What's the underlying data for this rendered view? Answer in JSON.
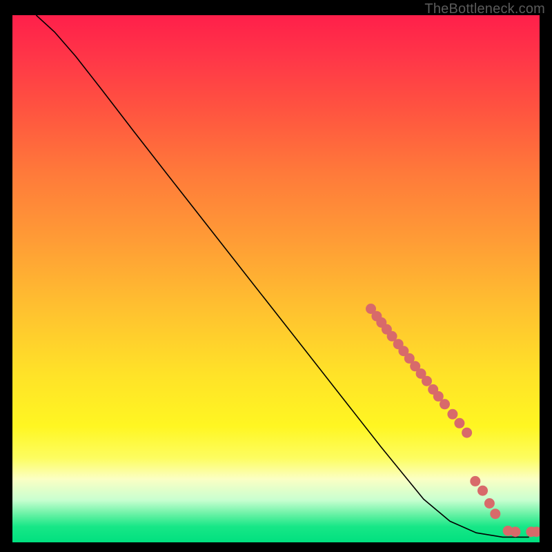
{
  "watermark": "TheBottleneck.com",
  "chart_data": {
    "type": "line",
    "title": "",
    "xlabel": "",
    "ylabel": "",
    "xlim": [
      0,
      1
    ],
    "ylim": [
      0,
      1
    ],
    "curve": [
      {
        "x": 0.045,
        "y": 1.0
      },
      {
        "x": 0.08,
        "y": 0.968
      },
      {
        "x": 0.12,
        "y": 0.922
      },
      {
        "x": 0.17,
        "y": 0.858
      },
      {
        "x": 0.23,
        "y": 0.78
      },
      {
        "x": 0.3,
        "y": 0.69
      },
      {
        "x": 0.38,
        "y": 0.588
      },
      {
        "x": 0.46,
        "y": 0.486
      },
      {
        "x": 0.54,
        "y": 0.384
      },
      {
        "x": 0.62,
        "y": 0.282
      },
      {
        "x": 0.7,
        "y": 0.18
      },
      {
        "x": 0.78,
        "y": 0.082
      },
      {
        "x": 0.83,
        "y": 0.04
      },
      {
        "x": 0.88,
        "y": 0.018
      },
      {
        "x": 0.93,
        "y": 0.01
      },
      {
        "x": 0.98,
        "y": 0.01
      }
    ],
    "markers": [
      {
        "x": 0.68,
        "y": 0.443
      },
      {
        "x": 0.691,
        "y": 0.429
      },
      {
        "x": 0.7,
        "y": 0.417
      },
      {
        "x": 0.71,
        "y": 0.404
      },
      {
        "x": 0.72,
        "y": 0.391
      },
      {
        "x": 0.732,
        "y": 0.376
      },
      {
        "x": 0.742,
        "y": 0.363
      },
      {
        "x": 0.753,
        "y": 0.349
      },
      {
        "x": 0.764,
        "y": 0.334
      },
      {
        "x": 0.775,
        "y": 0.32
      },
      {
        "x": 0.786,
        "y": 0.306
      },
      {
        "x": 0.798,
        "y": 0.29
      },
      {
        "x": 0.808,
        "y": 0.277
      },
      {
        "x": 0.82,
        "y": 0.262
      },
      {
        "x": 0.835,
        "y": 0.243
      },
      {
        "x": 0.848,
        "y": 0.226
      },
      {
        "x": 0.862,
        "y": 0.208
      },
      {
        "x": 0.878,
        "y": 0.116
      },
      {
        "x": 0.892,
        "y": 0.098
      },
      {
        "x": 0.905,
        "y": 0.074
      },
      {
        "x": 0.916,
        "y": 0.054
      },
      {
        "x": 0.94,
        "y": 0.022
      },
      {
        "x": 0.954,
        "y": 0.02
      },
      {
        "x": 0.984,
        "y": 0.02
      },
      {
        "x": 0.994,
        "y": 0.02
      }
    ],
    "marker_color": "#d86a6a",
    "curve_color": "#000000"
  }
}
